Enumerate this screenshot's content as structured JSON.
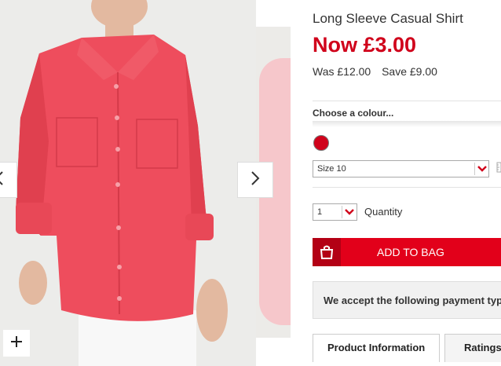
{
  "product": {
    "title": "Long Sleeve Casual Shirt",
    "price_now": "Now £3.00",
    "price_was": "Was £12.00",
    "price_save": "Save £9.00"
  },
  "colour": {
    "label": "Choose a colour...",
    "selected_hex": "#d0021b"
  },
  "size": {
    "selected": "Size 10"
  },
  "quantity": {
    "selected": "1",
    "label": "Quantity"
  },
  "actions": {
    "add_to_bag": "ADD TO BAG"
  },
  "payment": {
    "text": "We accept the following payment types"
  },
  "tabs": [
    {
      "label": "Product Information",
      "active": true
    },
    {
      "label": "Ratings",
      "active": false
    }
  ],
  "gallery": {
    "prev_icon": "chevron-left-icon",
    "next_icon": "chevron-right-icon",
    "zoom_icon": "plus-icon"
  },
  "colors": {
    "accent_red": "#e2001a",
    "price_red": "#d0021b",
    "shirt": "#ee4d5d"
  }
}
